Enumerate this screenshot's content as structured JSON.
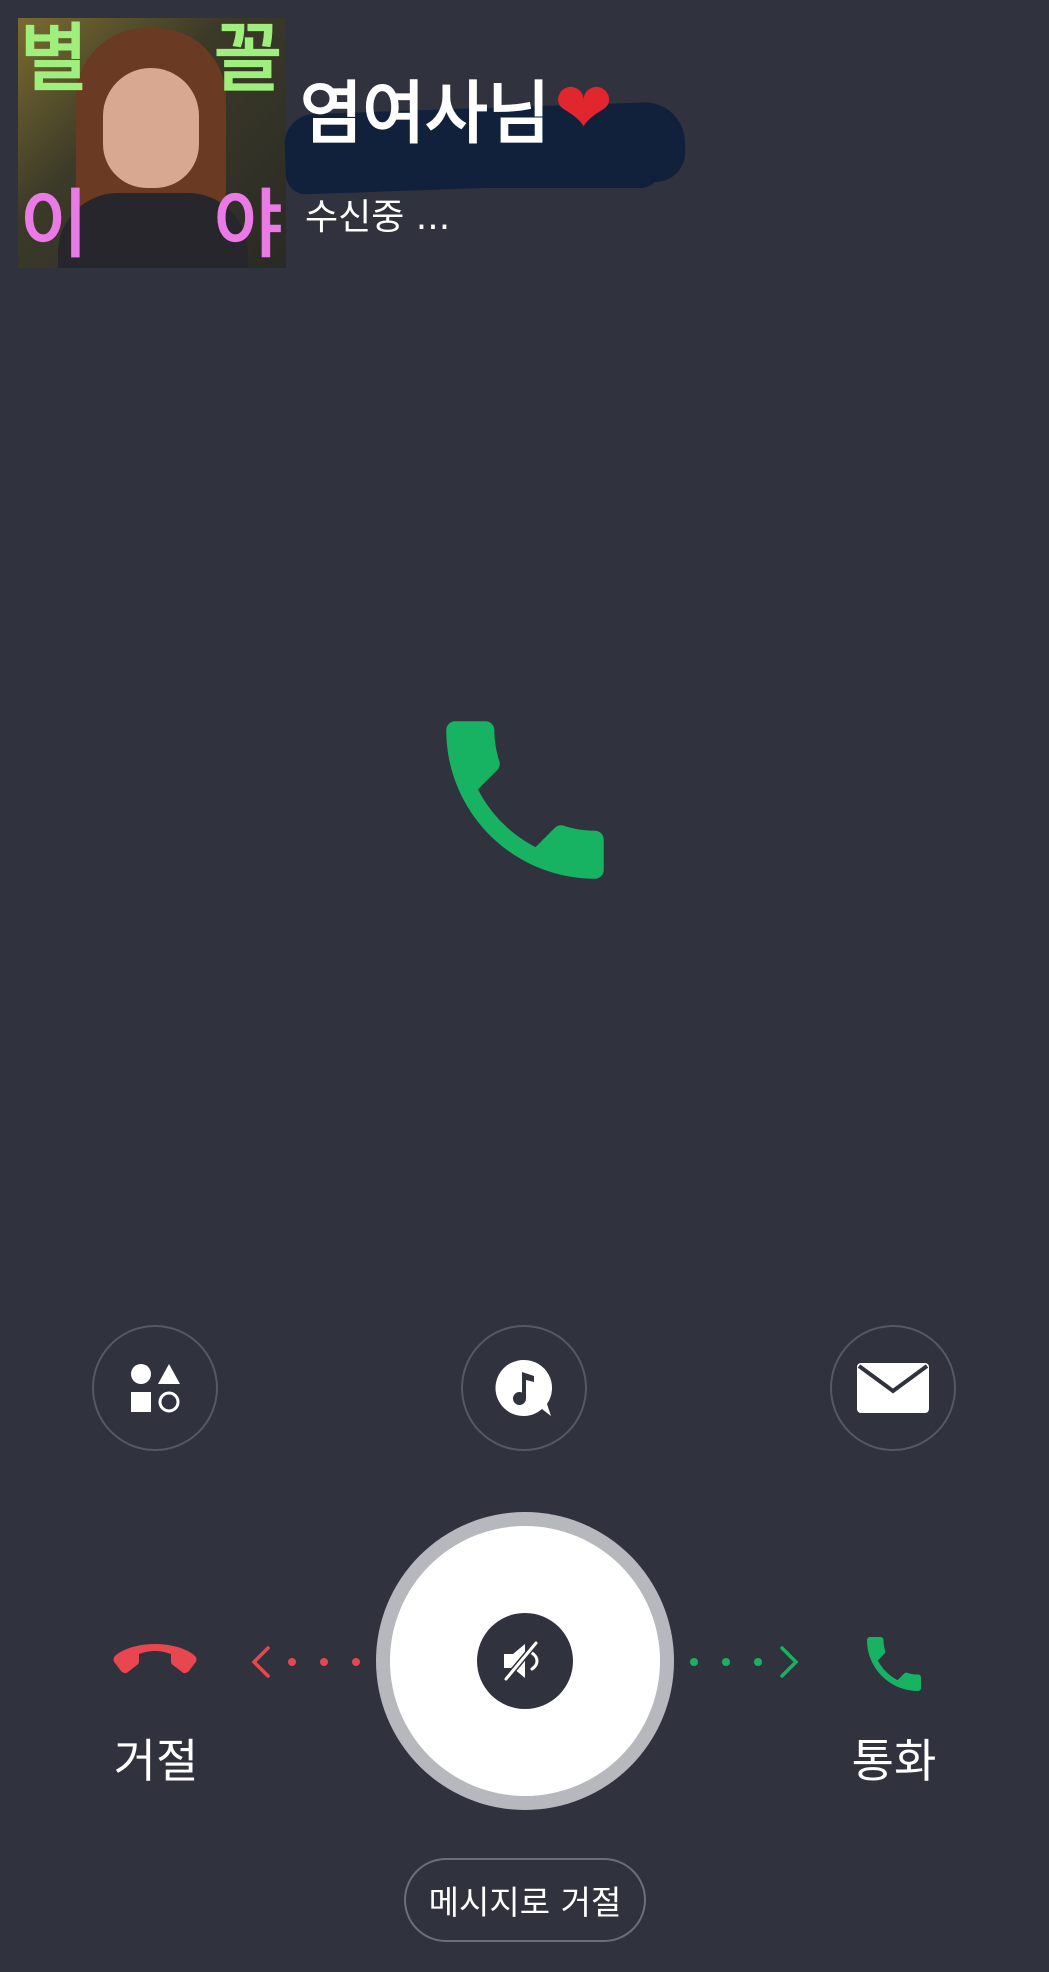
{
  "caller": {
    "name": "염여사님",
    "heart_emoji": "❤",
    "status": "수신중 ...",
    "avatar_text": [
      "별",
      "꼴",
      "이",
      "야"
    ]
  },
  "icons": {
    "center": "phone-icon",
    "apps": "shapes-icon",
    "ringtone": "music-note-icon",
    "message": "envelope-icon",
    "mute": "speaker-mute-icon",
    "decline": "phone-hangup-icon",
    "accept": "phone-icon"
  },
  "actions": {
    "decline_label": "거절",
    "accept_label": "통화",
    "reject_with_message": "메시지로 거절"
  },
  "colors": {
    "background": "#30323e",
    "accept": "#17b362",
    "decline": "#e8474f",
    "heart": "#e2262e"
  }
}
